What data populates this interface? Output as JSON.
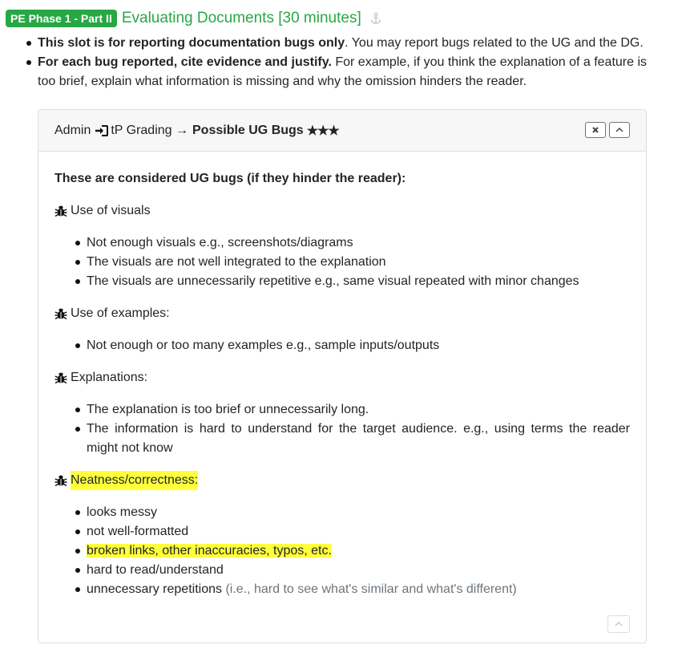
{
  "heading": {
    "badge": "PE Phase 1 - Part II",
    "title": "Evaluating Documents [30 minutes]",
    "anchor_icon": "anchor-icon"
  },
  "intro": [
    {
      "bold": "This slot is for reporting documentation bugs only",
      "rest": ". You may report bugs related to the UG and the DG."
    },
    {
      "bold": "For each bug reported, cite evidence and justify.",
      "rest": " For example, if you think the explanation of a feature is too brief, explain what information is missing and why the omission hinders the reader."
    }
  ],
  "card": {
    "header": {
      "crumb_admin": "Admin",
      "crumb_icon": "login-icon",
      "crumb_grading": "tP Grading →",
      "crumb_current": "Possible UG Bugs",
      "stars": "★★★",
      "close_icon": "close-icon",
      "collapse_icon": "chevron-up-icon"
    },
    "lead": "These are considered UG bugs (if they hinder the reader):",
    "sections": [
      {
        "title": "Use of visuals",
        "items": [
          "Not enough visuals e.g., screenshots/diagrams",
          "The visuals are not well integrated to the explanation",
          "The visuals are unnecessarily repetitive e.g., same visual repeated with minor changes"
        ]
      },
      {
        "title": "Use of examples:",
        "items": [
          "Not enough or too many examples e.g., sample inputs/outputs"
        ]
      },
      {
        "title": "Explanations:",
        "items": [
          "The explanation is too brief or unnecessarily long.",
          "The information is hard to understand for the target audience. e.g., using terms the reader might not know"
        ]
      },
      {
        "title": "Neatness/correctness:",
        "items": [
          "looks messy",
          "not well-formatted",
          "broken links, other inaccuracies, typos, etc.",
          "hard to read/understand",
          "unnecessary repetitions"
        ],
        "last_note": "(i.e., hard to see what's similar and what's different)"
      }
    ],
    "bug_icon": "bug-icon",
    "highlight_color": "#ffff3b",
    "footer_icon": "chevron-up-icon"
  },
  "colors": {
    "badge_bg": "#28a745",
    "title": "#28a745",
    "muted": "#6c757d"
  }
}
